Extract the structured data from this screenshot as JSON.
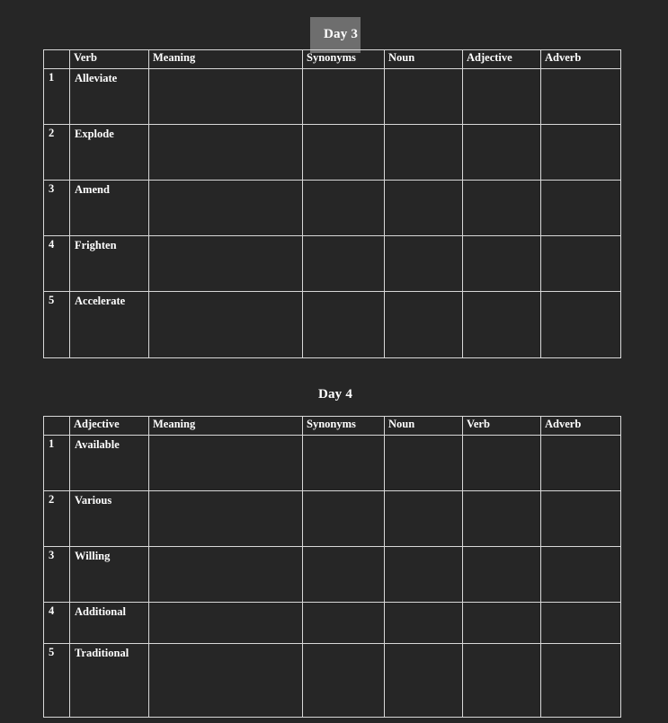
{
  "page": {
    "background_color": "#262626",
    "text_color": "#ffffff",
    "border_color": "#d8d8d8",
    "title_box_color": "#6e6e6e"
  },
  "sections": [
    {
      "title": "Day 3",
      "title_boxed": true,
      "table": {
        "columns": [
          "",
          "Verb",
          "Meaning",
          "Synonyms",
          "Noun",
          "Adjective",
          "Adverb"
        ],
        "rows": [
          {
            "index": "1",
            "word": "Alleviate",
            "meaning": "",
            "synonyms": "",
            "noun": "",
            "adjective": "",
            "adverb": ""
          },
          {
            "index": "2",
            "word": "Explode",
            "meaning": "",
            "synonyms": "",
            "noun": "",
            "adjective": "",
            "adverb": ""
          },
          {
            "index": "3",
            "word": "Amend",
            "meaning": "",
            "synonyms": "",
            "noun": "",
            "adjective": "",
            "adverb": ""
          },
          {
            "index": "4",
            "word": "Frighten",
            "meaning": "",
            "synonyms": "",
            "noun": "",
            "adjective": "",
            "adverb": ""
          },
          {
            "index": "5",
            "word": "Accelerate",
            "meaning": "",
            "synonyms": "",
            "noun": "",
            "adjective": "",
            "adverb": ""
          }
        ]
      }
    },
    {
      "title": "Day 4",
      "title_boxed": false,
      "table": {
        "columns": [
          "",
          "Adjective",
          "Meaning",
          "Synonyms",
          "Noun",
          "Verb",
          "Adverb"
        ],
        "rows": [
          {
            "index": "1",
            "word": "Available",
            "meaning": "",
            "synonyms": "",
            "noun": "",
            "verb": "",
            "adverb": ""
          },
          {
            "index": "2",
            "word": "Various",
            "meaning": "",
            "synonyms": "",
            "noun": "",
            "verb": "",
            "adverb": ""
          },
          {
            "index": "3",
            "word": "Willing",
            "meaning": "",
            "synonyms": "",
            "noun": "",
            "verb": "",
            "adverb": ""
          },
          {
            "index": "4",
            "word": "Additional",
            "meaning": "",
            "synonyms": "",
            "noun": "",
            "verb": "",
            "adverb": ""
          },
          {
            "index": "5",
            "word": "Traditional",
            "meaning": "",
            "synonyms": "",
            "noun": "",
            "verb": "",
            "adverb": ""
          }
        ]
      }
    }
  ]
}
